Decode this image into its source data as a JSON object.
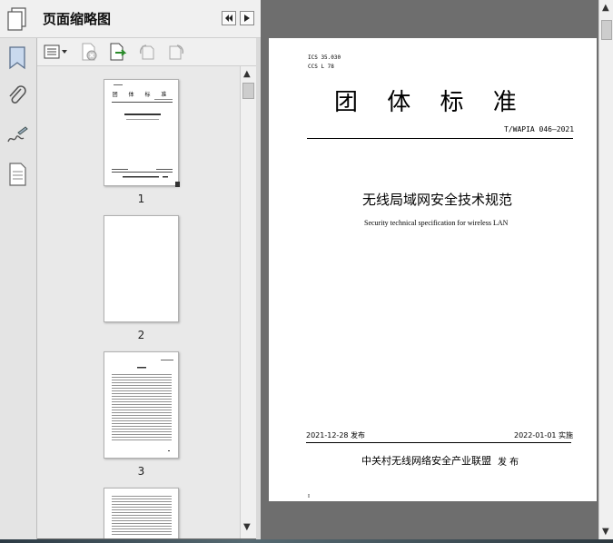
{
  "panel": {
    "title": "页面缩略图",
    "prev_icon": "rewind-icon",
    "next_icon": "play-icon"
  },
  "rail_icons": [
    "bookmark-icon",
    "paperclip-icon",
    "signature-icon",
    "page-icon"
  ],
  "toolbar_icons": [
    "thumbnail-options-icon",
    "delete-page-icon",
    "extract-page-icon",
    "rotate-left-icon",
    "rotate-right-icon"
  ],
  "thumbnails": [
    {
      "number": "1"
    },
    {
      "number": "2"
    },
    {
      "number": "3"
    }
  ],
  "document": {
    "ics": "ICS 35.030",
    "ccs": "CCS L 78",
    "banner": "团 体 标 准",
    "code": "T/WAPIA 046—2021",
    "title_cn": "无线局域网安全技术规范",
    "title_en": "Security technical specification for wireless LAN",
    "publish_date": "2021-12-28 发布",
    "implement_date": "2022-01-01 实施",
    "publisher": "中关村无线网络安全产业联盟",
    "publish_label": "发 布",
    "page_marker": "I"
  }
}
